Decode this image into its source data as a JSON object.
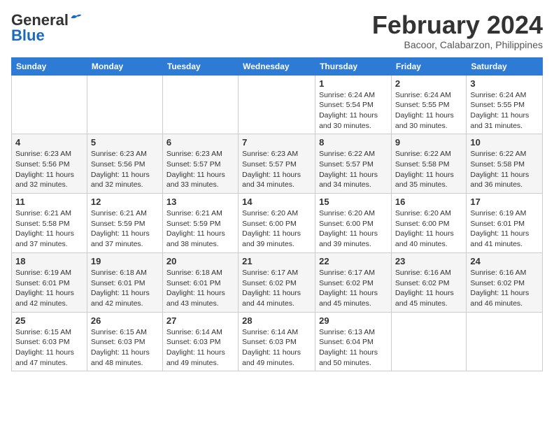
{
  "header": {
    "logo_line1": "General",
    "logo_line2": "Blue",
    "month": "February 2024",
    "location": "Bacoor, Calabarzon, Philippines"
  },
  "days_of_week": [
    "Sunday",
    "Monday",
    "Tuesday",
    "Wednesday",
    "Thursday",
    "Friday",
    "Saturday"
  ],
  "weeks": [
    [
      {
        "day": "",
        "info": ""
      },
      {
        "day": "",
        "info": ""
      },
      {
        "day": "",
        "info": ""
      },
      {
        "day": "",
        "info": ""
      },
      {
        "day": "1",
        "info": "Sunrise: 6:24 AM\nSunset: 5:54 PM\nDaylight: 11 hours and 30 minutes."
      },
      {
        "day": "2",
        "info": "Sunrise: 6:24 AM\nSunset: 5:55 PM\nDaylight: 11 hours and 30 minutes."
      },
      {
        "day": "3",
        "info": "Sunrise: 6:24 AM\nSunset: 5:55 PM\nDaylight: 11 hours and 31 minutes."
      }
    ],
    [
      {
        "day": "4",
        "info": "Sunrise: 6:23 AM\nSunset: 5:56 PM\nDaylight: 11 hours and 32 minutes."
      },
      {
        "day": "5",
        "info": "Sunrise: 6:23 AM\nSunset: 5:56 PM\nDaylight: 11 hours and 32 minutes."
      },
      {
        "day": "6",
        "info": "Sunrise: 6:23 AM\nSunset: 5:57 PM\nDaylight: 11 hours and 33 minutes."
      },
      {
        "day": "7",
        "info": "Sunrise: 6:23 AM\nSunset: 5:57 PM\nDaylight: 11 hours and 34 minutes."
      },
      {
        "day": "8",
        "info": "Sunrise: 6:22 AM\nSunset: 5:57 PM\nDaylight: 11 hours and 34 minutes."
      },
      {
        "day": "9",
        "info": "Sunrise: 6:22 AM\nSunset: 5:58 PM\nDaylight: 11 hours and 35 minutes."
      },
      {
        "day": "10",
        "info": "Sunrise: 6:22 AM\nSunset: 5:58 PM\nDaylight: 11 hours and 36 minutes."
      }
    ],
    [
      {
        "day": "11",
        "info": "Sunrise: 6:21 AM\nSunset: 5:58 PM\nDaylight: 11 hours and 37 minutes."
      },
      {
        "day": "12",
        "info": "Sunrise: 6:21 AM\nSunset: 5:59 PM\nDaylight: 11 hours and 37 minutes."
      },
      {
        "day": "13",
        "info": "Sunrise: 6:21 AM\nSunset: 5:59 PM\nDaylight: 11 hours and 38 minutes."
      },
      {
        "day": "14",
        "info": "Sunrise: 6:20 AM\nSunset: 6:00 PM\nDaylight: 11 hours and 39 minutes."
      },
      {
        "day": "15",
        "info": "Sunrise: 6:20 AM\nSunset: 6:00 PM\nDaylight: 11 hours and 39 minutes."
      },
      {
        "day": "16",
        "info": "Sunrise: 6:20 AM\nSunset: 6:00 PM\nDaylight: 11 hours and 40 minutes."
      },
      {
        "day": "17",
        "info": "Sunrise: 6:19 AM\nSunset: 6:01 PM\nDaylight: 11 hours and 41 minutes."
      }
    ],
    [
      {
        "day": "18",
        "info": "Sunrise: 6:19 AM\nSunset: 6:01 PM\nDaylight: 11 hours and 42 minutes."
      },
      {
        "day": "19",
        "info": "Sunrise: 6:18 AM\nSunset: 6:01 PM\nDaylight: 11 hours and 42 minutes."
      },
      {
        "day": "20",
        "info": "Sunrise: 6:18 AM\nSunset: 6:01 PM\nDaylight: 11 hours and 43 minutes."
      },
      {
        "day": "21",
        "info": "Sunrise: 6:17 AM\nSunset: 6:02 PM\nDaylight: 11 hours and 44 minutes."
      },
      {
        "day": "22",
        "info": "Sunrise: 6:17 AM\nSunset: 6:02 PM\nDaylight: 11 hours and 45 minutes."
      },
      {
        "day": "23",
        "info": "Sunrise: 6:16 AM\nSunset: 6:02 PM\nDaylight: 11 hours and 45 minutes."
      },
      {
        "day": "24",
        "info": "Sunrise: 6:16 AM\nSunset: 6:02 PM\nDaylight: 11 hours and 46 minutes."
      }
    ],
    [
      {
        "day": "25",
        "info": "Sunrise: 6:15 AM\nSunset: 6:03 PM\nDaylight: 11 hours and 47 minutes."
      },
      {
        "day": "26",
        "info": "Sunrise: 6:15 AM\nSunset: 6:03 PM\nDaylight: 11 hours and 48 minutes."
      },
      {
        "day": "27",
        "info": "Sunrise: 6:14 AM\nSunset: 6:03 PM\nDaylight: 11 hours and 49 minutes."
      },
      {
        "day": "28",
        "info": "Sunrise: 6:14 AM\nSunset: 6:03 PM\nDaylight: 11 hours and 49 minutes."
      },
      {
        "day": "29",
        "info": "Sunrise: 6:13 AM\nSunset: 6:04 PM\nDaylight: 11 hours and 50 minutes."
      },
      {
        "day": "",
        "info": ""
      },
      {
        "day": "",
        "info": ""
      }
    ]
  ]
}
